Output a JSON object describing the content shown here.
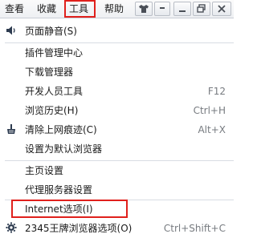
{
  "menubar": {
    "items": [
      "查看",
      "收藏",
      "工具",
      "帮助"
    ],
    "window_buttons": [
      {
        "name": "skin",
        "glyph": "👕"
      },
      {
        "name": "pin",
        "glyph": "—"
      },
      {
        "name": "minimize",
        "glyph": "▁"
      },
      {
        "name": "restore",
        "glyph": "❐"
      },
      {
        "name": "close",
        "glyph": "✕"
      }
    ]
  },
  "dropdown": {
    "items": [
      {
        "label": "页面静音(S)",
        "shortcut": "",
        "icon": "speaker-icon"
      },
      {
        "label": "插件管理中心",
        "shortcut": ""
      },
      {
        "label": "下载管理器",
        "shortcut": ""
      },
      {
        "label": "开发人员工具",
        "shortcut": "F12"
      },
      {
        "label": "浏览历史(H)",
        "shortcut": "Ctrl+H"
      },
      {
        "label": "清除上网痕迹(C)",
        "shortcut": "Alt+X",
        "icon": "broom-icon"
      },
      {
        "label": "设置为默认浏览器",
        "shortcut": ""
      },
      {
        "label": "主页设置",
        "shortcut": ""
      },
      {
        "label": "代理服务器设置",
        "shortcut": ""
      },
      {
        "label": "Internet选项(I)",
        "shortcut": ""
      },
      {
        "label": "2345王牌浏览器选项(O)",
        "shortcut": "Ctrl+Shift+C",
        "icon": "gear-icon"
      }
    ]
  },
  "colors": {
    "highlight": "#e0201c",
    "icon": "#2d3b4f"
  }
}
